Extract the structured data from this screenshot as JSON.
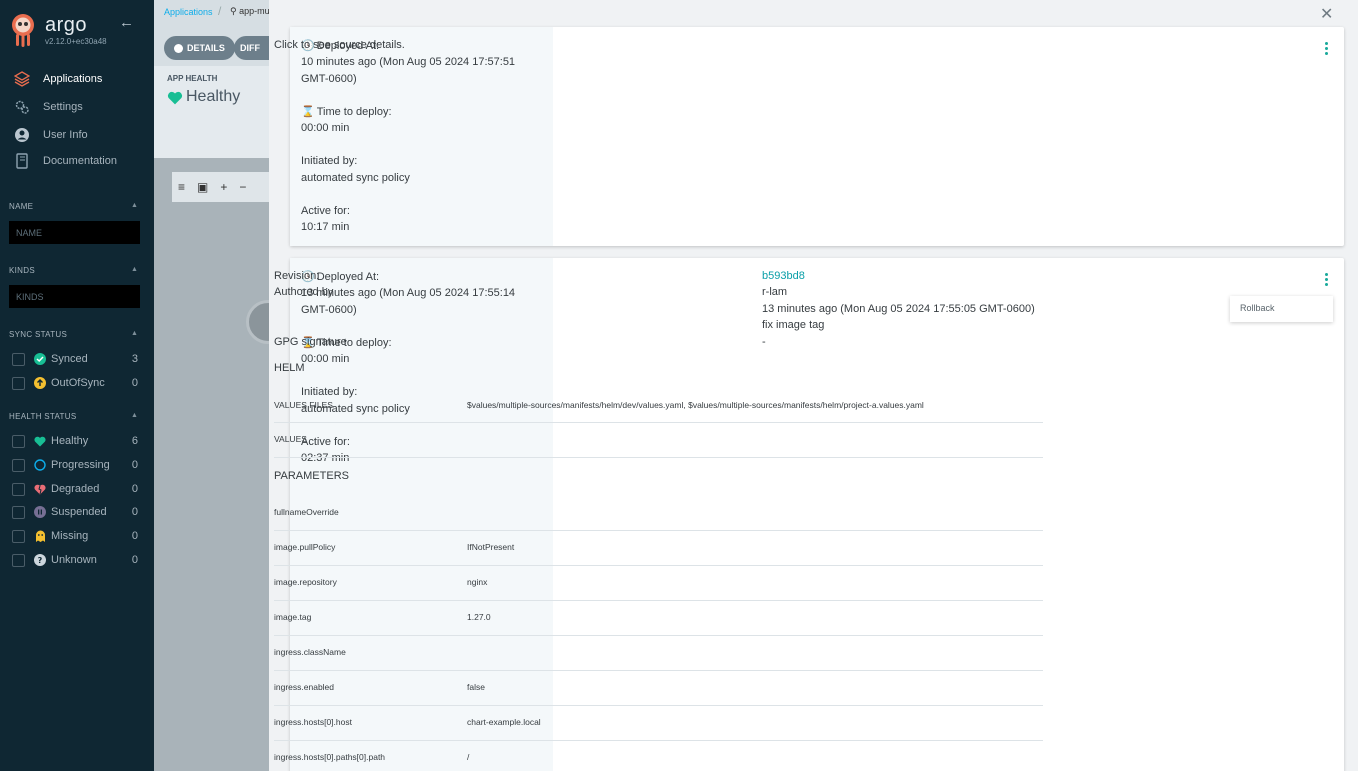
{
  "sidebar": {
    "brand": "argo",
    "version": "v2.12.0+ec30a48",
    "nav": [
      {
        "label": "Applications",
        "icon": "layers-icon"
      },
      {
        "label": "Settings",
        "icon": "gears-icon"
      },
      {
        "label": "User Info",
        "icon": "user-icon"
      },
      {
        "label": "Documentation",
        "icon": "book-icon"
      }
    ],
    "name_title": "NAME",
    "name_placeholder": "NAME",
    "kinds_title": "KINDS",
    "kinds_placeholder": "KINDS",
    "sync_title": "SYNC STATUS",
    "sync": [
      {
        "label": "Synced",
        "count": "3",
        "color": "#18be94"
      },
      {
        "label": "OutOfSync",
        "count": "0",
        "color": "#f4c030"
      }
    ],
    "health_title": "HEALTH STATUS",
    "health": [
      {
        "label": "Healthy",
        "count": "6",
        "color": "#18be94"
      },
      {
        "label": "Progressing",
        "count": "0",
        "color": "#0dadea"
      },
      {
        "label": "Degraded",
        "count": "0",
        "color": "#e96d76"
      },
      {
        "label": "Suspended",
        "count": "0",
        "color": "#766f94"
      },
      {
        "label": "Missing",
        "count": "0",
        "color": "#f4c030"
      },
      {
        "label": "Unknown",
        "count": "0",
        "color": "#ccd6dd"
      }
    ]
  },
  "header": {
    "breadcrumb": "Applications",
    "search": "app-mu",
    "details_tab": "DETAILS",
    "diff_tab": "DIFF",
    "app_health_title": "APP HEALTH",
    "app_health_value": "Healthy"
  },
  "history": [
    {
      "deployed_label": "Deployed At:",
      "deployed_value": "10 minutes ago (Mon Aug 05 2024 17:57:51 GMT-0600)",
      "time_label": "Time to deploy:",
      "time_value": "00:00 min",
      "initiated_label": "Initiated by:",
      "initiated_value": "automated sync policy",
      "active_label": "Active for:",
      "active_value": "10:17 min",
      "source_link": "Click to see source details."
    },
    {
      "deployed_label": "Deployed At:",
      "deployed_value": "13 minutes ago (Mon Aug 05 2024 17:55:14 GMT-0600)",
      "time_label": "Time to deploy:",
      "time_value": "00:00 min",
      "initiated_label": "Initiated by:",
      "initiated_value": "automated sync policy",
      "active_label": "Active for:",
      "active_value": "02:37 min",
      "revision_label": "Revision:",
      "revision_value": "b593bd8",
      "authored_label": "Authored by",
      "authored_value": "r-lam",
      "authored_time": "13 minutes ago (Mon Aug 05 2024 17:55:05 GMT-0600)",
      "commit_msg": "fix image tag",
      "gpg_label": "GPG signature",
      "gpg_value": "-",
      "helm_title": "HELM",
      "values_files_label": "VALUES FILES",
      "values_files_value": "$values/multiple-sources/manifests/helm/dev/values.yaml, $values/multiple-sources/manifests/helm/project-a.values.yaml",
      "values_label": "VALUES",
      "parameters_title": "PARAMETERS",
      "parameters": [
        {
          "key": "fullnameOverride",
          "value": ""
        },
        {
          "key": "image.pullPolicy",
          "value": "IfNotPresent"
        },
        {
          "key": "image.repository",
          "value": "nginx"
        },
        {
          "key": "image.tag",
          "value": "1.27.0"
        },
        {
          "key": "ingress.className",
          "value": ""
        },
        {
          "key": "ingress.enabled",
          "value": "false"
        },
        {
          "key": "ingress.hosts[0].host",
          "value": "chart-example.local"
        },
        {
          "key": "ingress.hosts[0].paths[0].path",
          "value": "/"
        }
      ],
      "menu_rollback": "Rollback"
    }
  ]
}
